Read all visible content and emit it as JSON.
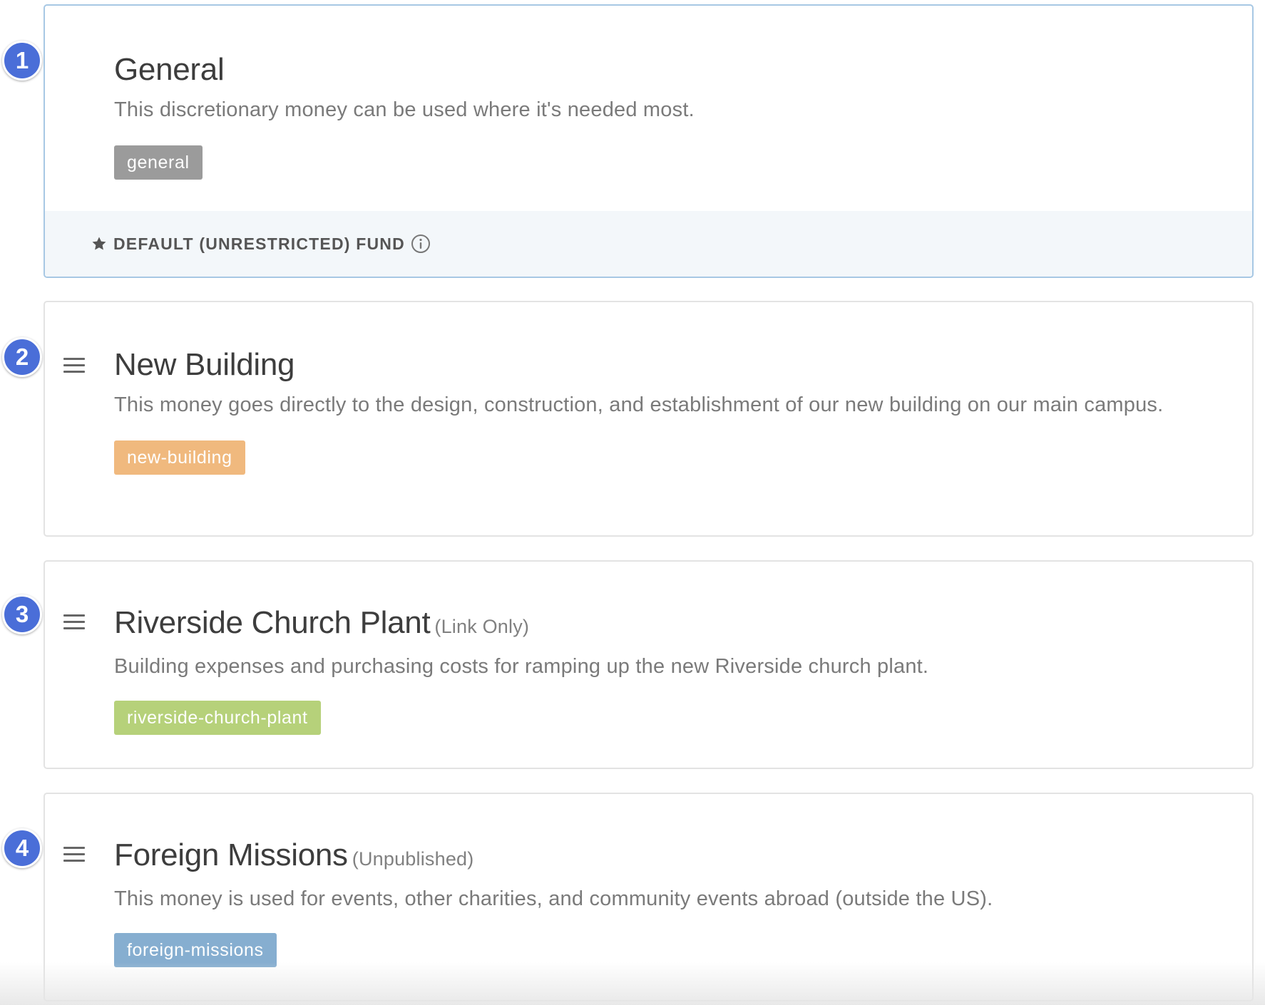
{
  "funds": [
    {
      "step": "1",
      "title": "General",
      "qualifier": "",
      "description": "This discretionary money can be used where it's needed most.",
      "tag": "general",
      "tag_color": "#9b9b9b",
      "is_default": true,
      "default_label": "DEFAULT (UNRESTRICTED) FUND"
    },
    {
      "step": "2",
      "title": "New Building",
      "qualifier": "",
      "description": "This money goes directly to the design, construction, and establishment of our new building on our main campus.",
      "tag": "new-building",
      "tag_color": "#f0b97e"
    },
    {
      "step": "3",
      "title": "Riverside Church Plant",
      "qualifier": "(Link Only)",
      "description": "Building expenses and purchasing costs for ramping up the new Riverside church plant.",
      "tag": "riverside-church-plant",
      "tag_color": "#b6d17a"
    },
    {
      "step": "4",
      "title": "Foreign Missions",
      "qualifier": "(Unpublished)",
      "description": "This money is used for events, other charities, and community events abroad (outside the US).",
      "tag": "foreign-missions",
      "tag_color": "#86aed0"
    }
  ],
  "icons": {
    "star": "star-icon",
    "info": "info-icon",
    "drag": "drag-handle-icon"
  },
  "colors": {
    "badge": "#4a6ed8",
    "default_border": "#a7c8e4",
    "footer_bg": "#f3f7fa"
  }
}
